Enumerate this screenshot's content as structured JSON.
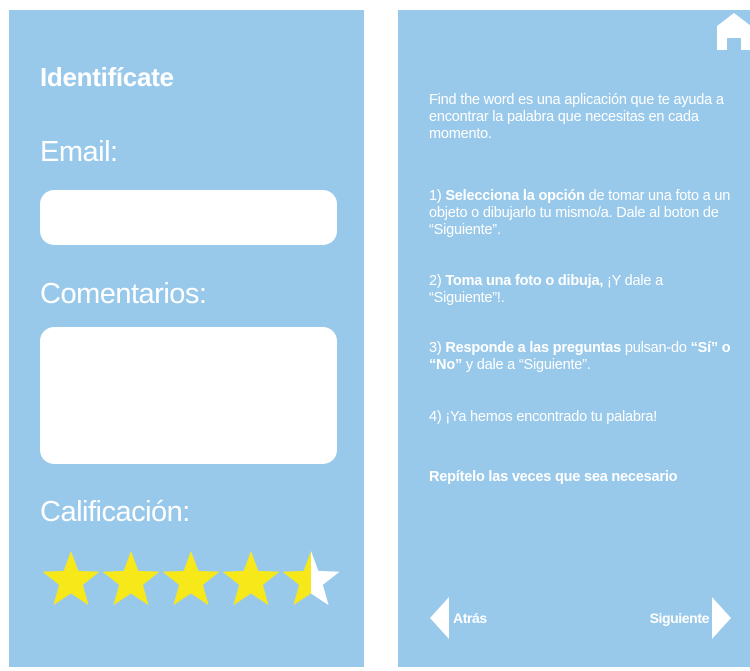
{
  "login_panel": {
    "title": "Identifícate",
    "email_label": "Email:",
    "email_value": "",
    "comments_label": "Comentarios:",
    "comments_value": "",
    "rating_label": "Calificación:",
    "rating": {
      "value": 4.5,
      "max": 5,
      "fill_color": "#f7e81a",
      "empty_color": "#ffffff"
    }
  },
  "help_panel": {
    "home_icon": "home-icon",
    "intro": "Find the word es una aplicación que te ayuda a encontrar la palabra que necesitas en cada momento.",
    "step1": {
      "prefix": "1) ",
      "bold": "Selecciona la opción",
      "rest": " de tomar una foto a un objeto o dibujarlo tu mismo/a. Dale al boton de “Siguiente”."
    },
    "step2": {
      "prefix": "2) ",
      "bold": "Toma una foto o dibuja,",
      "rest": " ¡Y dale a “Siguiente”!."
    },
    "step3": {
      "prefix": "3) ",
      "bold": "Responde a las preguntas",
      "mid": " pulsan-do ",
      "bold2": "“Sí” o “No”",
      "rest": " y dale a “Siguiente”."
    },
    "step4": "4) ¡Ya hemos encontrado tu palabra!",
    "repeat": "Repítelo las veces que sea necesario",
    "back_label": "Atrás",
    "next_label": "Siguiente"
  },
  "colors": {
    "panel_bg": "#99c9ea",
    "text": "#ffffff",
    "star": "#f7e81a"
  }
}
